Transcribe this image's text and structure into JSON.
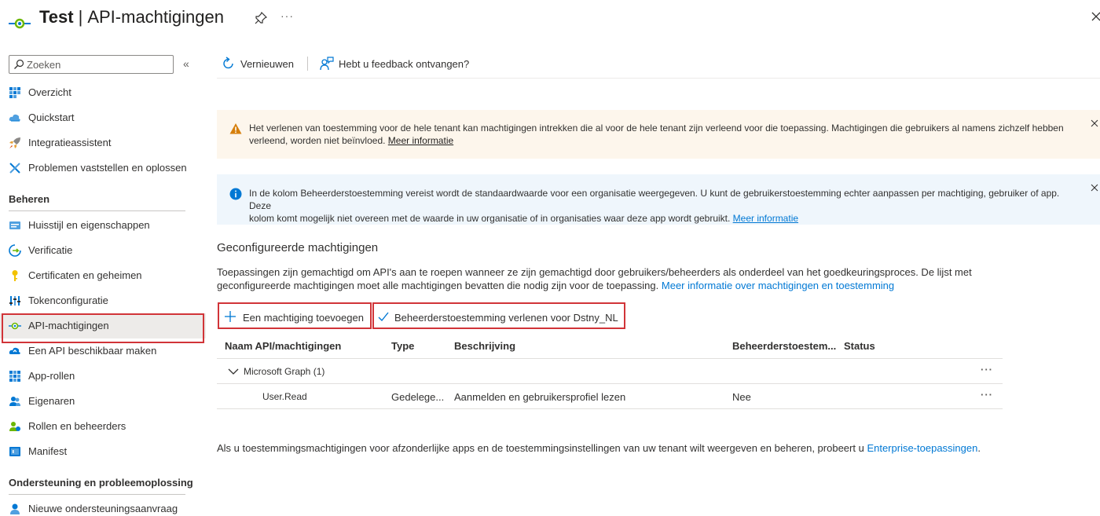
{
  "header": {
    "app_name": "Test",
    "separator": "|",
    "page_title": "API-machtigingen",
    "more": "···"
  },
  "sidebar": {
    "search_placeholder": "Zoeken",
    "collapse": "«",
    "items_top": [
      {
        "label": "Overzicht",
        "icon": "overview-grid-icon"
      },
      {
        "label": "Quickstart",
        "icon": "cloud-quickstart-icon"
      },
      {
        "label": "Integratieassistent",
        "icon": "rocket-icon"
      },
      {
        "label": "Problemen vaststellen en oplossen",
        "icon": "wrench-icon"
      }
    ],
    "section_manage": "Beheren",
    "items_manage": [
      {
        "label": "Huisstijl en eigenschappen",
        "icon": "branding-icon"
      },
      {
        "label": "Verificatie",
        "icon": "authentication-icon"
      },
      {
        "label": "Certificaten en geheimen",
        "icon": "key-icon"
      },
      {
        "label": "Tokenconfiguratie",
        "icon": "token-bars-icon"
      },
      {
        "label": "API-machtigingen",
        "icon": "api-permissions-icon",
        "active": true
      },
      {
        "label": "Een API beschikbaar maken",
        "icon": "cloud-expose-icon"
      },
      {
        "label": "App-rollen",
        "icon": "app-roles-grid-icon"
      },
      {
        "label": "Eigenaren",
        "icon": "owners-people-icon"
      },
      {
        "label": "Rollen en beheerders",
        "icon": "roles-admins-icon"
      },
      {
        "label": "Manifest",
        "icon": "manifest-icon"
      }
    ],
    "section_support": "Ondersteuning en probleemoplossing",
    "items_support": [
      {
        "label": "Nieuwe ondersteuningsaanvraag",
        "icon": "support-person-icon"
      }
    ]
  },
  "toolbar": {
    "refresh_label": "Vernieuwen",
    "feedback_label": "Hebt u feedback ontvangen?"
  },
  "warning_banner": {
    "line1": "Het verlenen van toestemming voor de hele tenant kan machtigingen intrekken die al voor de hele tenant zijn verleend voor die toepassing. Machtigingen die gebruikers al namens zichzelf hebben",
    "line2": "verleend, worden niet beïnvloed.",
    "link": "Meer informatie"
  },
  "info_banner": {
    "line1": "In de kolom Beheerderstoestemming vereist wordt de standaardwaarde voor een organisatie weergegeven. U kunt de gebruikerstoestemming echter aanpassen per machtiging, gebruiker of app. Deze",
    "line2": "kolom komt mogelijk niet overeen met de waarde in uw organisatie of in organisaties waar deze app wordt gebruikt.",
    "link": "Meer informatie"
  },
  "configured": {
    "heading": "Geconfigureerde machtigingen",
    "desc_line1": "Toepassingen zijn gemachtigd om API's aan te roepen wanneer ze zijn gemachtigd door gebruikers/beheerders als onderdeel van het goedkeuringsproces. De lijst met",
    "desc_line2": "geconfigureerde machtigingen moet alle machtigingen bevatten die nodig zijn voor de toepassing.",
    "desc_link": "Meer informatie over machtigingen en toestemming",
    "add_button": "Een machtiging toevoegen",
    "grant_button": "Beheerderstoestemming verlenen voor Dstny_NL"
  },
  "table": {
    "headers": {
      "name": "Naam API/machtigingen",
      "type": "Type",
      "description": "Beschrijving",
      "admin_consent": "Beheerderstoestem...",
      "status": "Status"
    },
    "group": {
      "label": "Microsoft Graph (1)"
    },
    "rows": [
      {
        "name": "User.Read",
        "type": "Gedelege...",
        "description": "Aanmelden en gebruikersprofiel lezen",
        "admin_consent": "Nee",
        "status": ""
      }
    ],
    "more": "···"
  },
  "footer": {
    "text": "Als u toestemmingsmachtigingen voor afzonderlijke apps en de toestemmingsinstellingen van uw tenant wilt weergeven en beheren, probeert u",
    "link": "Enterprise-toepassingen",
    "end": "."
  },
  "colors": {
    "accent": "#0078d4",
    "highlight_border": "#d13438",
    "warning_bg": "#fdf6ec",
    "info_bg": "#eff6fc",
    "warning_icon": "#d67f0b"
  }
}
